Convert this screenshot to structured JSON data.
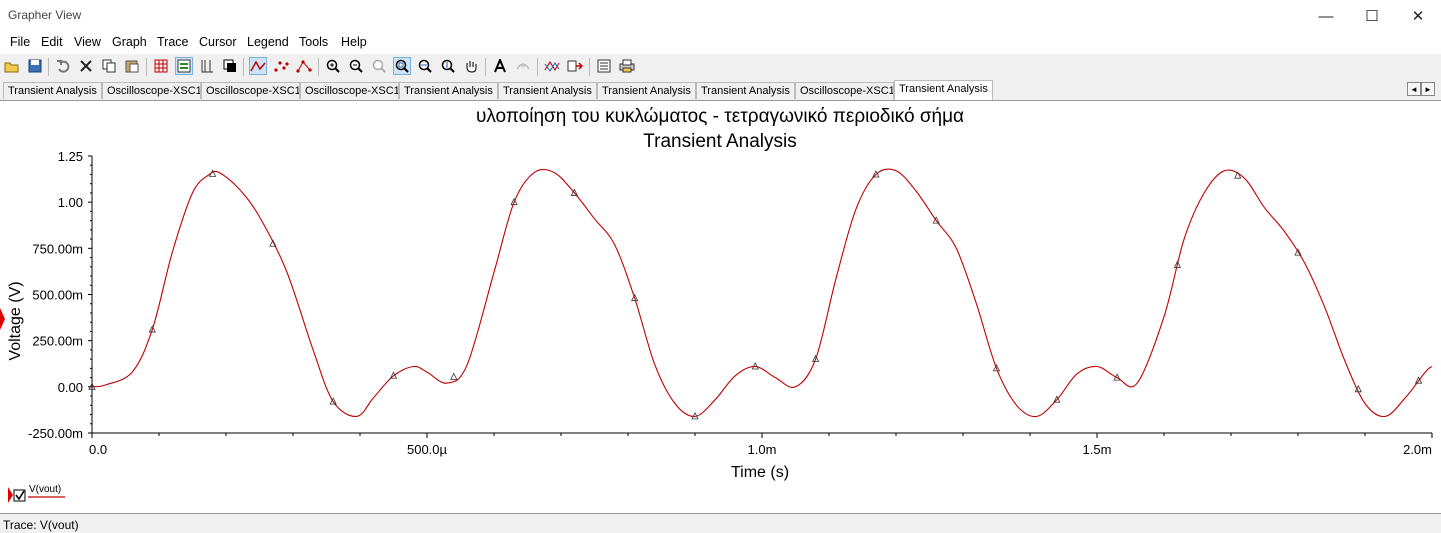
{
  "window": {
    "title": "Grapher View",
    "minimize_glyph": "—",
    "maximize_glyph": "☐",
    "close_glyph": "✕"
  },
  "menu": [
    "File",
    "Edit",
    "View",
    "Graph",
    "Trace",
    "Cursor",
    "Legend",
    "Tools",
    "Help"
  ],
  "toolbar_icons": [
    "open-icon",
    "save-icon",
    "undo-icon",
    "cut-icon",
    "copy-icon",
    "paste-icon",
    "grid-icon",
    "legend-icon",
    "cursor-toggle-icon",
    "black-bg-icon",
    "line-trace-icon",
    "scatter-trace-icon",
    "line-point-trace-icon",
    "zoom-in-icon",
    "zoom-out-icon",
    "zoom-fit-icon",
    "zoom-area-icon",
    "zoom-x-icon",
    "zoom-y-icon",
    "pan-icon",
    "text-icon",
    "marker-icon",
    "overlay-traces-icon",
    "export-icon",
    "properties-icon",
    "print-icon"
  ],
  "tabs": [
    {
      "label": "Transient Analysis",
      "active": false
    },
    {
      "label": "Oscilloscope-XSC1",
      "active": false
    },
    {
      "label": "Oscilloscope-XSC1",
      "active": false
    },
    {
      "label": "Oscilloscope-XSC1",
      "active": false
    },
    {
      "label": "Transient Analysis",
      "active": false
    },
    {
      "label": "Transient Analysis",
      "active": false
    },
    {
      "label": "Transient Analysis",
      "active": false
    },
    {
      "label": "Transient Analysis",
      "active": false
    },
    {
      "label": "Oscilloscope-XSC1",
      "active": false
    },
    {
      "label": "Transient Analysis",
      "active": true
    }
  ],
  "tab_scroll": {
    "left": "◄",
    "right": "►"
  },
  "chart_data": {
    "type": "line",
    "title": "υλοποίηση του κυκλώματος -  τετραγωνικό περιοδικό σήμα",
    "subtitle": "Transient Analysis",
    "xlabel": "Time (s)",
    "ylabel": "Voltage (V)",
    "xlim": [
      0,
      0.002
    ],
    "ylim": [
      -0.25,
      1.25
    ],
    "x_ticks": [
      {
        "value": 0,
        "label": "0.0"
      },
      {
        "value": 0.0005,
        "label": "500.0µ"
      },
      {
        "value": 0.001,
        "label": "1.0m"
      },
      {
        "value": 0.0015,
        "label": "1.5m"
      },
      {
        "value": 0.002,
        "label": "2.0m"
      }
    ],
    "y_ticks": [
      {
        "value": 1.25,
        "label": "1.25"
      },
      {
        "value": 1.0,
        "label": "1.00"
      },
      {
        "value": 0.75,
        "label": "750.00m"
      },
      {
        "value": 0.5,
        "label": "500.00m"
      },
      {
        "value": 0.25,
        "label": "250.00m"
      },
      {
        "value": 0.0,
        "label": "0.00"
      },
      {
        "value": -0.25,
        "label": "-250.00m"
      }
    ],
    "grid": false,
    "legend_position": "bottom-left",
    "series": [
      {
        "name": "V(vout)",
        "color": "#c00000",
        "x": [
          0,
          2e-05,
          6e-05,
          9e-05,
          0.00012,
          0.00015,
          0.000175,
          0.00019,
          0.00022,
          0.00025,
          0.00029,
          0.00033,
          0.00036,
          0.000395,
          0.00042,
          0.00045,
          0.00048,
          0.0005,
          0.00053,
          0.00056,
          0.0006,
          0.00063,
          0.00066,
          0.00069,
          0.00072,
          0.00075,
          0.00078,
          0.00081,
          0.00084,
          0.00087,
          0.0009,
          0.00093,
          0.00096,
          0.00099,
          0.00102,
          0.00105,
          0.00108,
          0.00111,
          0.00114,
          0.00117,
          0.0012,
          0.00123,
          0.00126,
          0.00129,
          0.00132,
          0.00135,
          0.00138,
          0.00141,
          0.00144,
          0.00147,
          0.0015,
          0.00153,
          0.00156,
          0.0016,
          0.00163,
          0.00166,
          0.00169,
          0.00172,
          0.00175,
          0.00178,
          0.00181,
          0.00184,
          0.00187,
          0.0019,
          0.00193,
          0.00196,
          0.00199,
          0.002
        ],
        "y": [
          0.0,
          0.01,
          0.08,
          0.31,
          0.73,
          1.05,
          1.15,
          1.16,
          1.07,
          0.92,
          0.63,
          0.2,
          -0.08,
          -0.16,
          -0.06,
          0.06,
          0.11,
          0.08,
          0.02,
          0.12,
          0.62,
          1.0,
          1.16,
          1.16,
          1.05,
          0.91,
          0.77,
          0.48,
          0.12,
          -0.09,
          -0.16,
          -0.07,
          0.06,
          0.11,
          0.05,
          0.0,
          0.15,
          0.58,
          0.96,
          1.15,
          1.17,
          1.06,
          0.9,
          0.75,
          0.45,
          0.1,
          -0.1,
          -0.16,
          -0.07,
          0.07,
          0.11,
          0.05,
          0.02,
          0.38,
          0.8,
          1.05,
          1.17,
          1.13,
          0.97,
          0.84,
          0.67,
          0.43,
          0.14,
          -0.09,
          -0.16,
          -0.06,
          0.08,
          0.11
        ]
      }
    ],
    "marker_x": [
      0,
      9e-05,
      0.00018,
      0.00027,
      0.00036,
      0.00045,
      0.00054,
      0.00063,
      0.00072,
      0.00081,
      0.0009,
      0.00099,
      0.00108,
      0.00117,
      0.00126,
      0.00135,
      0.00144,
      0.00153,
      0.00162,
      0.00171,
      0.0018,
      0.00189,
      0.00198
    ]
  },
  "legend": {
    "checkbox_checked": true,
    "label": "V(vout)"
  },
  "status": {
    "text": "Trace: V(vout)"
  }
}
